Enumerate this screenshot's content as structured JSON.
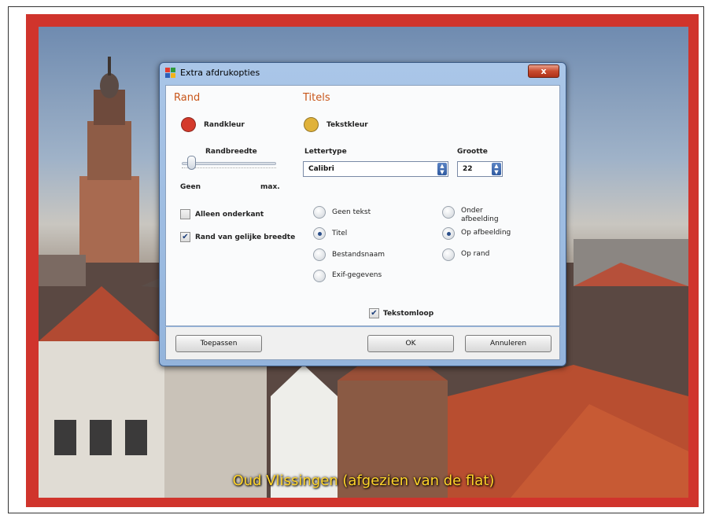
{
  "photo": {
    "caption": "Oud Vlissingen (afgezien van de flat)"
  },
  "dialog": {
    "title": "Extra afdrukopties",
    "close": "x",
    "rand": {
      "heading": "Rand",
      "color_label": "Randkleur",
      "color": "#d43a2b",
      "width_label": "Randbreedte",
      "min_label": "Geen",
      "max_label": "max.",
      "only_bottom": {
        "label": "Alleen onderkant",
        "checked": false
      },
      "equal_width": {
        "label": "Rand van gelijke breedte",
        "checked": true
      }
    },
    "titels": {
      "heading": "Titels",
      "color_label": "Tekstkleur",
      "color": "#e0b23a",
      "font_label": "Lettertype",
      "font_value": "Calibri",
      "size_label": "Grootte",
      "size_value": "22",
      "text_options": [
        {
          "label": "Geen tekst",
          "selected": false
        },
        {
          "label": "Titel",
          "selected": true
        },
        {
          "label": "Bestandsnaam",
          "selected": false
        },
        {
          "label": "Exif-gegevens",
          "selected": false
        }
      ],
      "position_options": [
        {
          "label": "Onder afbeelding",
          "selected": false
        },
        {
          "label": "Op afbeelding",
          "selected": true
        },
        {
          "label": "Op rand",
          "selected": false
        }
      ],
      "wrap": {
        "label": "Tekstomloop",
        "checked": true
      }
    },
    "buttons": {
      "apply": "Toepassen",
      "ok": "OK",
      "cancel": "Annuleren"
    }
  }
}
